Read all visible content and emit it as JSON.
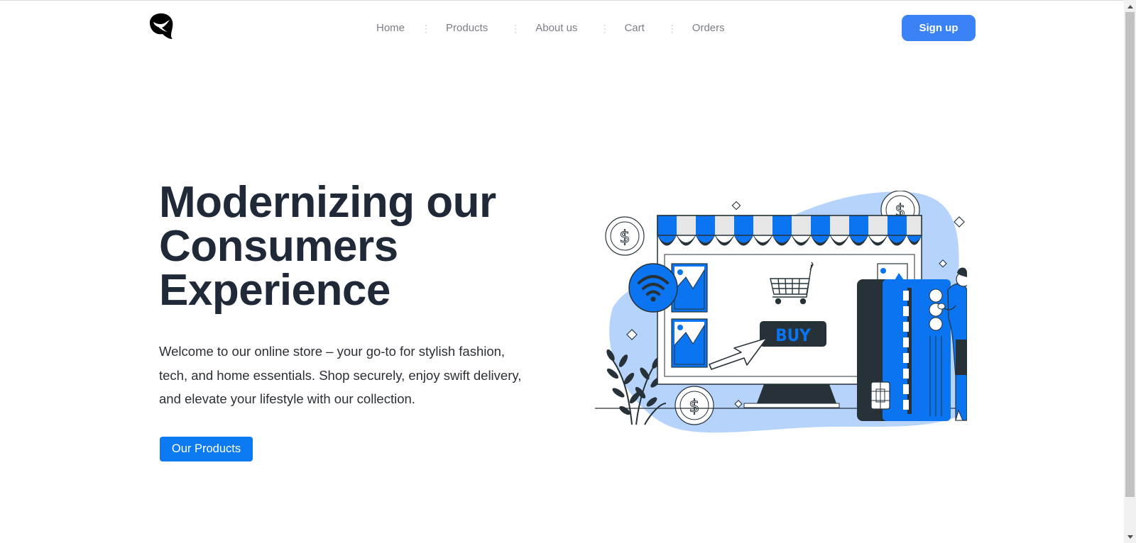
{
  "header": {
    "logo_icon": "leaf-bird-logo",
    "nav": [
      {
        "label": "Home"
      },
      {
        "label": "Products"
      },
      {
        "label": "About us"
      },
      {
        "label": "Cart"
      },
      {
        "label": "Orders"
      }
    ],
    "nav_separator": "⋮",
    "signup_label": "Sign up"
  },
  "hero": {
    "headline": [
      "Modernizing our",
      "Consumers",
      "Experience"
    ],
    "description": "Welcome to our online store – your go-to for stylish fashion, tech, and home essentials. Shop securely, enjoy swift delivery, and elevate your lifestyle with our collection.",
    "cta_label": "Our Products",
    "illustration": {
      "name": "online-storefront-illustration",
      "buy_label": "BUY",
      "coin_symbol": "$"
    }
  },
  "colors": {
    "accent": "#3b82f6",
    "cta": "#0b7af3",
    "illustration_blue": "#0b74f0",
    "illustration_light": "#b6d4fb",
    "dark": "#263238",
    "heading": "#1f2937"
  }
}
